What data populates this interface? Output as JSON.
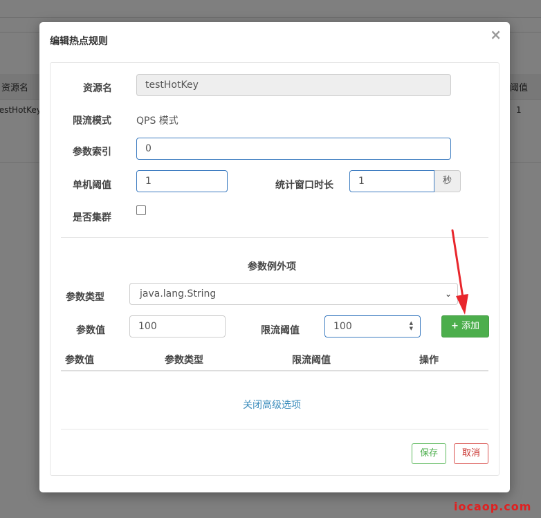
{
  "background": {
    "col_resource": "资源名",
    "col_threshold": "阈值",
    "row_resource": "testHotKey",
    "row_threshold": "1"
  },
  "modal": {
    "title": "编辑热点规则",
    "close": "×"
  },
  "form": {
    "resource_label": "资源名",
    "resource_value": "testHotKey",
    "mode_label": "限流模式",
    "mode_value": "QPS 模式",
    "param_index_label": "参数索引",
    "param_index_value": "0",
    "single_threshold_label": "单机阈值",
    "single_threshold_value": "1",
    "window_label": "统计窗口时长",
    "window_value": "1",
    "window_unit": "秒",
    "cluster_label": "是否集群",
    "cluster_checked": false
  },
  "exceptions": {
    "section_title": "参数例外项",
    "param_type_label": "参数类型",
    "param_type_value": "java.lang.String",
    "param_value_label": "参数值",
    "param_value_value": "100",
    "limit_threshold_label": "限流阈值",
    "limit_threshold_value": "100",
    "add_button": "添加",
    "table_headers": [
      "参数值",
      "参数类型",
      "限流阈值",
      "操作"
    ]
  },
  "advanced_link": "关闭高级选项",
  "footer": {
    "save": "保存",
    "cancel": "取消"
  },
  "watermark": "iocaop.com",
  "colors": {
    "add_button_bg": "#4cae4c",
    "link": "#3c8dbc",
    "focus_border": "#3b7bc0",
    "arrow": "#e8262c"
  }
}
